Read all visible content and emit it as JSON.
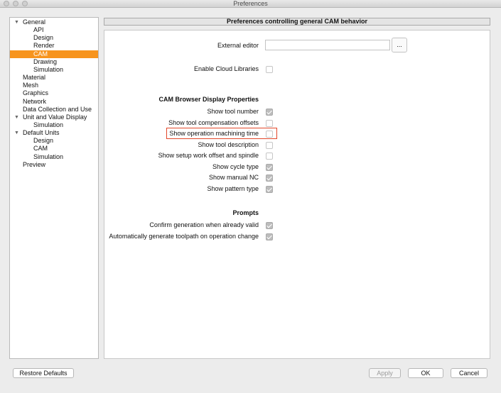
{
  "window": {
    "title": "Preferences"
  },
  "tree": [
    {
      "label": "General",
      "level": 0,
      "expanded": true
    },
    {
      "label": "API",
      "level": 2
    },
    {
      "label": "Design",
      "level": 2
    },
    {
      "label": "Render",
      "level": 2
    },
    {
      "label": "CAM",
      "level": 2,
      "selected": true
    },
    {
      "label": "Drawing",
      "level": 2
    },
    {
      "label": "Simulation",
      "level": 2
    },
    {
      "label": "Material",
      "level": 0
    },
    {
      "label": "Mesh",
      "level": 0
    },
    {
      "label": "Graphics",
      "level": 0
    },
    {
      "label": "Network",
      "level": 0
    },
    {
      "label": "Data Collection and Use",
      "level": 0
    },
    {
      "label": "Unit and Value Display",
      "level": 0,
      "expanded": true
    },
    {
      "label": "Simulation",
      "level": 2
    },
    {
      "label": "Default Units",
      "level": 0,
      "expanded": true
    },
    {
      "label": "Design",
      "level": 2
    },
    {
      "label": "CAM",
      "level": 2
    },
    {
      "label": "Simulation",
      "level": 2
    },
    {
      "label": "Preview",
      "level": 0
    }
  ],
  "panel": {
    "header": "Preferences controlling general CAM behavior",
    "external_editor_label": "External editor",
    "external_editor_value": "",
    "browse_label": "...",
    "cloud_libraries_label": "Enable Cloud Libraries",
    "cloud_libraries_checked": false,
    "browser_section_title": "CAM Browser Display Properties",
    "browser_options": [
      {
        "label": "Show tool number",
        "checked": true
      },
      {
        "label": "Show tool compensation offsets",
        "checked": false
      },
      {
        "label": "Show operation machining time",
        "checked": false,
        "highlighted": true
      },
      {
        "label": "Show tool description",
        "checked": false
      },
      {
        "label": "Show setup work offset and spindle",
        "checked": false
      },
      {
        "label": "Show cycle type",
        "checked": true
      },
      {
        "label": "Show manual NC",
        "checked": true
      },
      {
        "label": "Show pattern type",
        "checked": true
      }
    ],
    "prompts_section_title": "Prompts",
    "prompt_options": [
      {
        "label": "Confirm generation when already valid",
        "checked": true
      },
      {
        "label": "Automatically generate toolpath on operation change",
        "checked": true
      }
    ]
  },
  "buttons": {
    "restore": "Restore Defaults",
    "apply": "Apply",
    "ok": "OK",
    "cancel": "Cancel"
  },
  "colors": {
    "selection": "#f7941d",
    "highlight_border": "#e2472a"
  }
}
